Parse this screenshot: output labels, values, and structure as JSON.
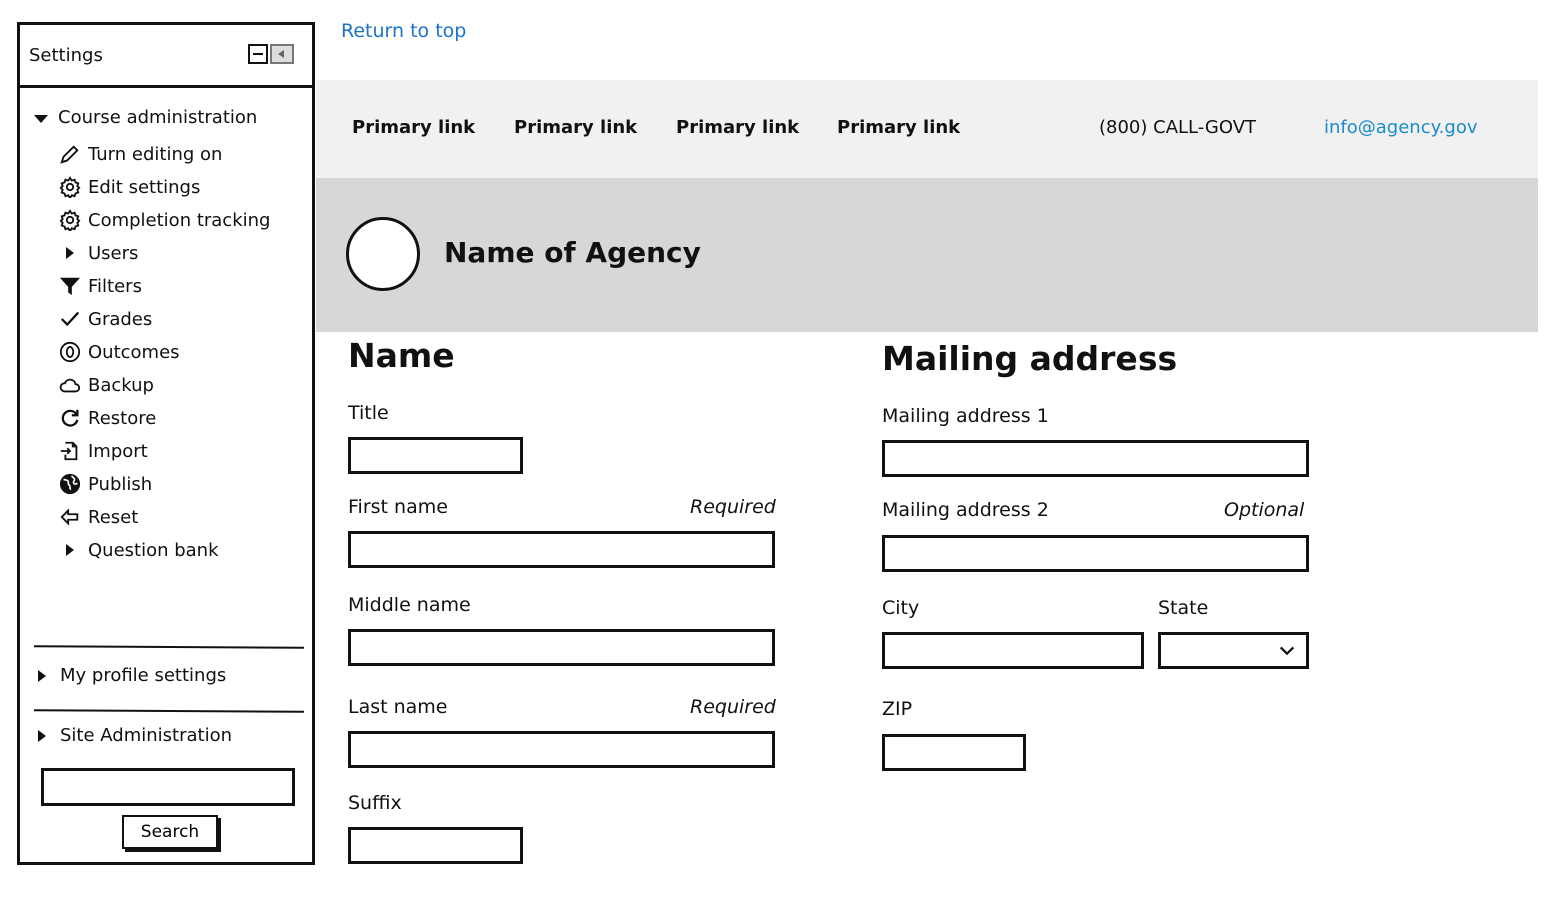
{
  "settings": {
    "title": "Settings",
    "course_admin": {
      "label": "Course administration",
      "items": [
        {
          "label": "Turn editing on",
          "icon": "pencil-icon"
        },
        {
          "label": "Edit settings",
          "icon": "gear-icon"
        },
        {
          "label": "Completion tracking",
          "icon": "gear-icon"
        },
        {
          "label": "Users",
          "icon": "caret-right-icon"
        },
        {
          "label": "Filters",
          "icon": "filter-icon"
        },
        {
          "label": "Grades",
          "icon": "checkmark-icon"
        },
        {
          "label": "Outcomes",
          "icon": "outcomes-icon"
        },
        {
          "label": "Backup",
          "icon": "cloud-icon"
        },
        {
          "label": "Restore",
          "icon": "restore-icon"
        },
        {
          "label": "Import",
          "icon": "import-icon"
        },
        {
          "label": "Publish",
          "icon": "globe-icon"
        },
        {
          "label": "Reset",
          "icon": "reset-arrow-icon"
        },
        {
          "label": "Question bank",
          "icon": "caret-right-icon"
        }
      ]
    },
    "my_profile_label": "My profile settings",
    "site_admin_label": "Site Administration",
    "search_value": "",
    "search_button": "Search"
  },
  "return_link": "Return to top",
  "nav": {
    "links": [
      "Primary link",
      "Primary link",
      "Primary link",
      "Primary link"
    ],
    "phone": "(800) CALL-GOVT",
    "email": "info@agency.gov"
  },
  "agency": {
    "name": "Name of Agency"
  },
  "name_form": {
    "heading": "Name",
    "title_label": "Title",
    "first_label": "First name",
    "first_hint": "Required",
    "middle_label": "Middle name",
    "last_label": "Last name",
    "last_hint": "Required",
    "suffix_label": "Suffix"
  },
  "address_form": {
    "heading": "Mailing address",
    "addr1_label": "Mailing address 1",
    "addr2_label": "Mailing address 2",
    "addr2_hint": "Optional",
    "city_label": "City",
    "state_label": "State",
    "state_value": "",
    "zip_label": "ZIP"
  },
  "colors": {
    "link": "#1a73c9",
    "email": "#1a8bcc",
    "nav_bg": "#f1f1f1",
    "banner_bg": "#d6d7d8"
  }
}
